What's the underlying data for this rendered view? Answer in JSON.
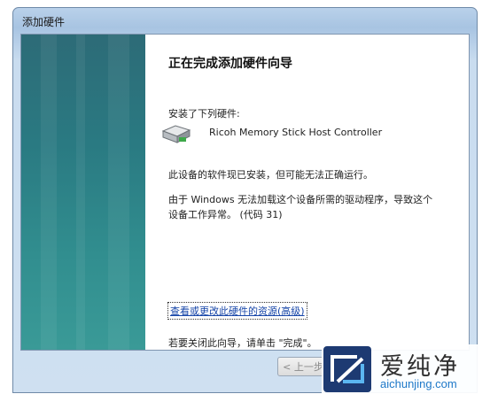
{
  "window": {
    "title": "添加硬件"
  },
  "wizard": {
    "heading": "正在完成添加硬件向导",
    "installed_label": "安装了下列硬件:",
    "device_name": "Ricoh Memory Stick Host Controller",
    "status_line": "此设备的软件现已安装，但可能无法正确运行。",
    "error_line1": "由于 Windows 无法加载这个设备所需的驱动程序，导致这个",
    "error_line2": "设备工作异常。 (代码 31)",
    "resource_link": "查看或更改此硬件的资源(高级)",
    "close_hint": "若要关闭此向导，请单击 \"完成\"。"
  },
  "buttons": {
    "back_label": "< 上一步"
  },
  "watermark": {
    "brand": "爱纯净",
    "url": "aichunjing.com"
  },
  "icons": {
    "device": "hardware-device-icon",
    "logo": "aichunjing-logo-icon"
  },
  "colors": {
    "banner": "#2a7a82",
    "link": "#1645a8",
    "watermark_url": "#1e78c8"
  }
}
